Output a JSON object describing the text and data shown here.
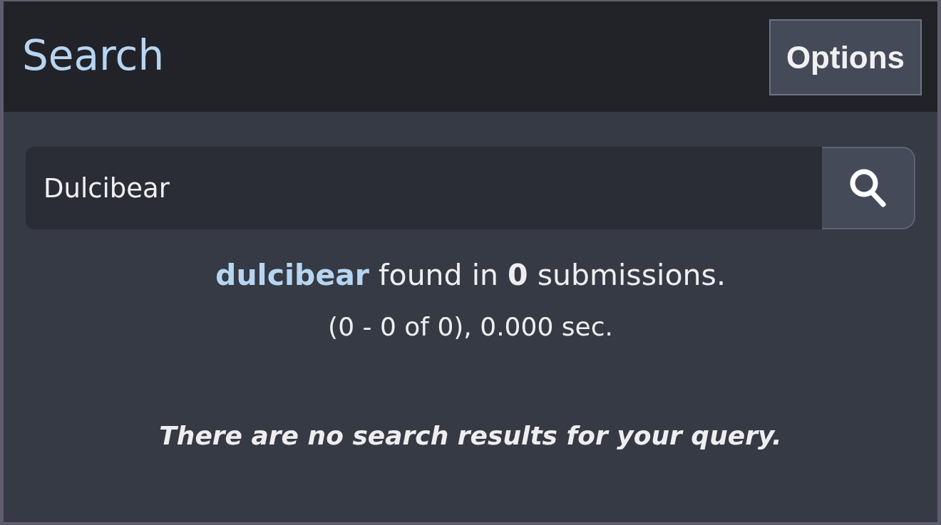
{
  "header": {
    "title": "Search",
    "options_button": "Options"
  },
  "search": {
    "value": "Dulcibear"
  },
  "summary": {
    "query": "dulcibear",
    "middle": "found in",
    "count": "0",
    "end": "submissions."
  },
  "range": "(0 - 0 of 0), 0.000 sec.",
  "message": "There are no search results for your query."
}
